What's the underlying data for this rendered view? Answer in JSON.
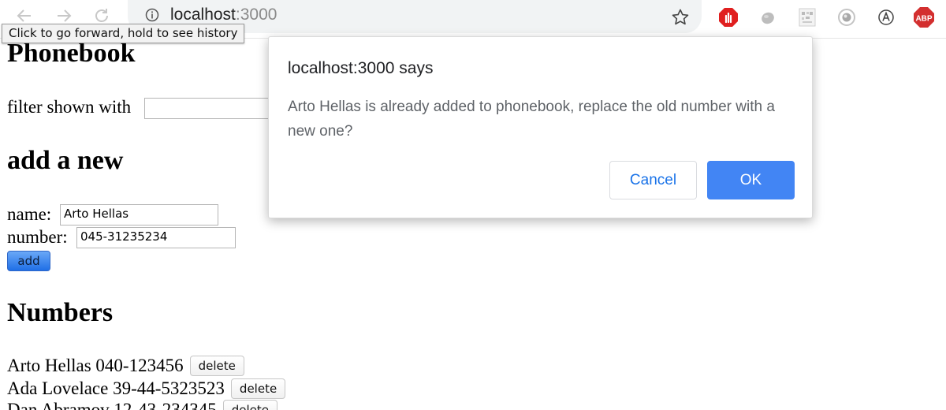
{
  "browser": {
    "url_host": "localhost",
    "url_port": ":3000",
    "icons": [
      "back-icon",
      "forward-icon",
      "reload-icon",
      "info-icon",
      "bookmark-star-icon",
      "adblock-stop-icon",
      "extension-blob-icon",
      "extension-qr-icon",
      "extension-target-icon",
      "extension-a-icon",
      "adblock-plus-icon"
    ],
    "abp_label": "ABP"
  },
  "tooltip": {
    "text": "Click to go forward, hold to see history"
  },
  "app": {
    "title": "Phonebook",
    "filter_label": "filter shown with",
    "filter_value": "",
    "add_heading": "add a new",
    "name_label": "name:",
    "name_value": "Arto Hellas",
    "number_label": "number:",
    "number_value": "045-31235234",
    "add_button": "add",
    "numbers_heading": "Numbers",
    "entries": [
      {
        "text": "Arto Hellas 040-123456",
        "delete_label": "delete"
      },
      {
        "text": "Ada Lovelace 39-44-5323523",
        "delete_label": "delete"
      },
      {
        "text": "Dan Abramov 12-43-234345",
        "delete_label": "delete"
      }
    ]
  },
  "dialog": {
    "title": "localhost:3000 says",
    "message": "Arto Hellas is already added to phonebook, replace the old number with a new one?",
    "cancel_label": "Cancel",
    "ok_label": "OK"
  },
  "colors": {
    "dialog_ok": "#4285f4",
    "dialog_cancel_text": "#1a73e8",
    "adblock_red": "#e01f1f"
  }
}
